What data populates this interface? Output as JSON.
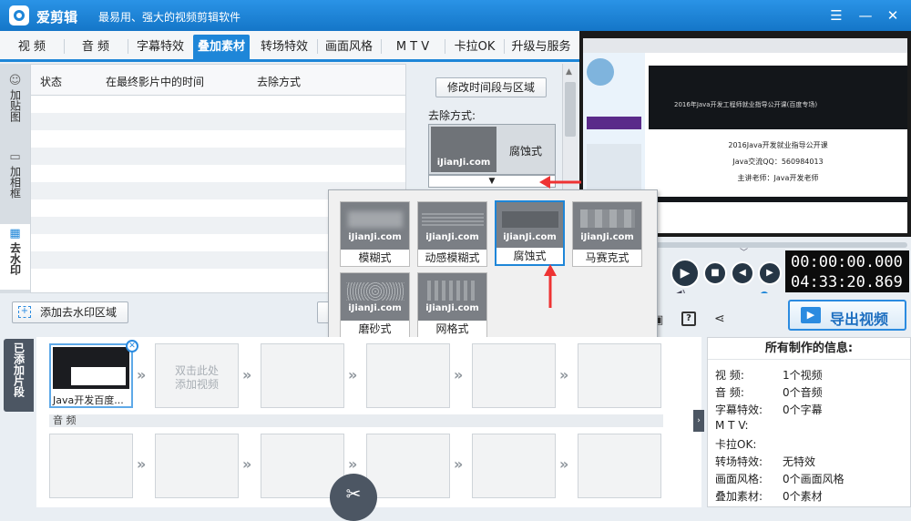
{
  "app": {
    "name": "爱剪辑",
    "slogan": "最易用、强大的视频剪辑软件"
  },
  "tabs": [
    "视 频",
    "音 频",
    "字幕特效",
    "叠加素材",
    "转场特效",
    "画面风格",
    "M T V",
    "卡拉OK",
    "升级与服务"
  ],
  "active_tab": "叠加素材",
  "side_tabs": [
    "加贴图",
    "加相框",
    "去水印"
  ],
  "table": {
    "columns": [
      "状态",
      "在最终影片中的时间",
      "去除方式"
    ]
  },
  "settings": {
    "modify_btn": "修改时间段与区域",
    "removal_label": "去除方式:",
    "current_mode": "腐蚀式",
    "watermark": "iJianJi.com"
  },
  "popup_options": [
    "模糊式",
    "动感模糊式",
    "腐蚀式",
    "马赛克式",
    "磨砂式",
    "网格式"
  ],
  "popup_selected": "腐蚀式",
  "add_watermark_btn": "添加去水印区域",
  "time": {
    "current": "00:00:00.000",
    "total": "04:33:20.869"
  },
  "export_btn": "导出视频",
  "timeline": {
    "side_label": "已添加片段",
    "clip_name": "Java开发百度...",
    "placeholder": "双击此处\n添加视频",
    "audio_label": "音 频"
  },
  "info": {
    "title": "所有制作的信息:",
    "rows": [
      {
        "k": "视 频:",
        "v": "1个视频"
      },
      {
        "k": "音 频:",
        "v": "0个音频"
      },
      {
        "k": "字幕特效:",
        "v": "0个字幕"
      },
      {
        "k": "M T V:",
        "v": ""
      },
      {
        "k": "卡拉OK:",
        "v": ""
      },
      {
        "k": "转场特效:",
        "v": "无特效"
      },
      {
        "k": "画面风格:",
        "v": "0个画面风格"
      },
      {
        "k": "叠加素材:",
        "v": "0个素材"
      }
    ]
  },
  "preview": {
    "slide_title": "2016年Java开发工程师就业指导公开课(百度专场)",
    "slide_line1": "2016Java开发就业指导公开课",
    "slide_line2": "Java交流QQ：560984013",
    "slide_line3": "主讲老师：Java开发老师"
  }
}
